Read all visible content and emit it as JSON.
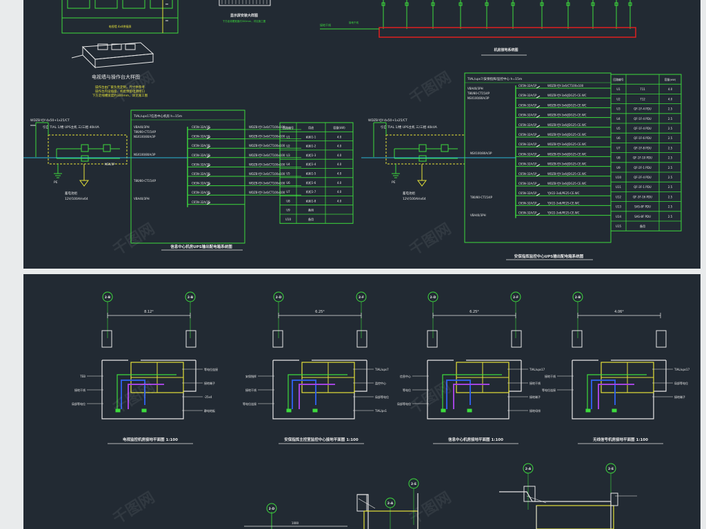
{
  "colors": {
    "background": "#222a33",
    "frame": "#e9ebec",
    "green": "#3ddc3d",
    "yellow": "#e5e23a",
    "white": "#e8e8e8",
    "cyan": "#29b7d6",
    "red": "#e02020",
    "blue": "#2f5de0",
    "purple": "#a444e0"
  },
  "watermark": "千图网",
  "top": {
    "ups_table_left": {
      "title": "TIAL/ups17信息中心机房 h=15m",
      "incoming_cable": "WDZB-YJY-4x50+1x25/CT",
      "incoming_note": "引自 TIAL 1/楼",
      "ups_label": "UPS主机 三/三相 40kVA",
      "main_breaker": "NSX100/80A/3P",
      "meter": "T80/80-CT15/4P",
      "spd": "VBA40/3PH",
      "battery_note": "蓄电池组",
      "battery_spec": "12V/100AHx64",
      "pe_label": "PE",
      "head_no": "回路编号",
      "head_use": "用途",
      "head_kw": "容量(kW)",
      "breakers": [
        "C65N-32A/3P",
        "C65N-32A/3P",
        "C65N-32A/3P",
        "C65N-32A/3P",
        "C65N-32A/3P",
        "C65N-32A/3P",
        "C65N-32A/3P",
        "C65N-32A/3P",
        "C65N-32A/3P"
      ],
      "cables": [
        "WDZB-YJY-3x6/CT100x100",
        "WDZB-YJY-3x6/CT100x100",
        "WDZB-YJY-3x6/CT100x100",
        "WDZB-YJY-3x6/CT100x100",
        "WDZB-YJY-3x6/CT100x100",
        "WDZB-YJY-3x6/CT100x100",
        "WDZB-YJY-3x6/CT100x100",
        "WDZB-YJY-3x6/CT100x100"
      ],
      "rows": [
        {
          "no": "U1",
          "use": "机柜1-1",
          "kw": "4.0"
        },
        {
          "no": "U2",
          "use": "机柜1-2",
          "kw": "4.0"
        },
        {
          "no": "U3",
          "use": "机柜1-3",
          "kw": "4.0"
        },
        {
          "no": "U4",
          "use": "机柜1-4",
          "kw": "4.0"
        },
        {
          "no": "U5",
          "use": "机柜1-5",
          "kw": "4.0"
        },
        {
          "no": "U6",
          "use": "机柜1-6",
          "kw": "4.0"
        },
        {
          "no": "U7",
          "use": "机柜1-7",
          "kw": "4.0"
        },
        {
          "no": "U8",
          "use": "机柜1-8",
          "kw": "4.0"
        },
        {
          "no": "U9",
          "use": "备用",
          "kw": ""
        },
        {
          "no": "U10",
          "use": "备用",
          "kw": ""
        }
      ],
      "caption": "信息中心机房UPS输出配电箱系统图"
    },
    "ups_table_right": {
      "title": "TIAL/ups7/安保指挥/监控中心 h=15m",
      "incoming_cable": "WDZB-YJY-4x50+1x25/CT",
      "incoming_note": "引自 TIAL 1/楼",
      "ups_label": "UPS主机 三/三相 40kVA",
      "main_breaker": "NSX100/80A/3P",
      "meter": "T80/80-CT15/4P",
      "spd": "VBA40/3PH",
      "battery_note": "蓄电池组",
      "battery_spec": "12V/100AHx64",
      "pe_label": "PE",
      "head_no": "回路编号",
      "head_kw": "容量(kW)",
      "breakers": [
        "C65N-32A/1P",
        "C65N-32A/1P",
        "C65N-32A/1P",
        "C65N-32A/1P",
        "C65N-32A/1P",
        "C65N-32A/1P",
        "C65N-32A/1P",
        "C65N-32A/1P",
        "C65N-32A/1P",
        "C65N-32A/1P",
        "C65N-32A/1P",
        "C65N-32A/1P",
        "C65N-32A/1P",
        "C65N-32A/1P"
      ],
      "cables": [
        "WDZB-YJY-3x6/CT100x100",
        "WDZB-YJY-3x6/JDG25-CE.WC",
        "WDZB-YJY-3x6/JDG25-CE.WC",
        "WDZB-YJY-3x6/JDG25-CE.WC",
        "WDZB-YJY-3x6/JDG25-CE.WC",
        "WDZB-YJY-3x6/JDG25-CE.WC",
        "WDZB-YJY-3x6/JDG25-CE.WC",
        "WDZB-YJY-3x6/JDG25-CE.WC",
        "WDZB-YJY-3x6/JDG25-CE.WC",
        "WDZB-YJY-3x6/JDG25-CE.WC",
        "WDZB-YJY-3x6/JDG25-CE.WC",
        "YJV22-3x6/PE25-CE.WC",
        "YJV22-3x6/PE25-CE.WC",
        "YJV22-3x6/PE25-CE.WC"
      ],
      "rows": [
        {
          "no": "U1",
          "use": "711",
          "kw": "4.0"
        },
        {
          "no": "U2",
          "use": "712",
          "kw": "4.0"
        },
        {
          "no": "U3",
          "use": "QF-1F-4 PDU",
          "kw": "2.5"
        },
        {
          "no": "U4",
          "use": "QF-1F-4 PDU",
          "kw": "2.5"
        },
        {
          "no": "U5",
          "use": "QF-1F-4 PDU",
          "kw": "2.5"
        },
        {
          "no": "U6",
          "use": "QF-1F-6 PDU",
          "kw": "2.5"
        },
        {
          "no": "U7",
          "use": "QF-1F-8 PDU",
          "kw": "2.5"
        },
        {
          "no": "U8",
          "use": "QF-1F-10 PDU",
          "kw": "2.5"
        },
        {
          "no": "U9",
          "use": "QF-2F-1 PDU",
          "kw": "2.5"
        },
        {
          "no": "U10",
          "use": "QF-2F-4 PDU",
          "kw": "2.5"
        },
        {
          "no": "U11",
          "use": "QF-3F-1 PDU",
          "kw": "2.5"
        },
        {
          "no": "U12",
          "use": "QF-3F-16 PDU",
          "kw": "2.5"
        },
        {
          "no": "U13",
          "use": "SAS-8F PDU",
          "kw": "2.5"
        },
        {
          "no": "U14",
          "use": "SAS-8F PDU",
          "kw": "2.5"
        },
        {
          "no": "U15",
          "use": "备用",
          "kw": ""
        }
      ],
      "caption": "安保指挥监控中心UPS输出配电箱系统图"
    },
    "console_caption": "电视墙与操作台大样图",
    "console_note_lines": [
      "操作台由厂家负责定制，尺寸供参考",
      "操作台内设插座、机柜预留电源接口",
      "下方走线槽宽度约300mm，详见施工图"
    ],
    "tv_wall_caption": "显示屏安装大样图",
    "tv_wall_note": "电视墙 4x4拼接屏",
    "wiring_caption": "机房接地系统图",
    "grounding_label": "接地干线"
  },
  "bottom": {
    "plans": [
      {
        "axis_l": "2-B",
        "axis_r": "2-B",
        "dim": "8.12°",
        "caption": "电视监控机房接地平面图 1:100",
        "labels": [
          "等电位连接",
          "TEB",
          "接地端子",
          "接地干线",
          "-25x4",
          "局部等电位",
          "静电地板"
        ]
      },
      {
        "axis_l": "2-D",
        "axis_r": "2-F",
        "dim": "6.25°",
        "caption": "安保指挥主控室监控中心接地平面图 1:100",
        "labels": [
          "TIAL/ups7",
          "安保指挥",
          "监控中心",
          "接地干线",
          "局部等电位",
          "等电位连接",
          "TIAL/ps1"
        ]
      },
      {
        "axis_l": "2-D",
        "axis_r": "2-F",
        "dim": "6.25°",
        "caption": "信息中心机房接地平面图 1:100",
        "labels": [
          "TIAL/ups17",
          "信息中心",
          "接地干线",
          "等电位",
          "接地端子",
          "局部等电位",
          "接地母排"
        ]
      },
      {
        "axis_l": "2-B",
        "axis_r": "",
        "dim": "4.06°",
        "caption": "无线信号机房接地平面图 1:100",
        "labels": [
          "TIAL/ups17",
          "接地干线",
          "局部等电位",
          "等电位连接",
          "接地端子"
        ]
      }
    ],
    "lower": {
      "axis_a": "2-D",
      "axis_b": "2-H",
      "axis_c": "2-A",
      "axis_d": "2-E",
      "dim": "1000"
    }
  }
}
